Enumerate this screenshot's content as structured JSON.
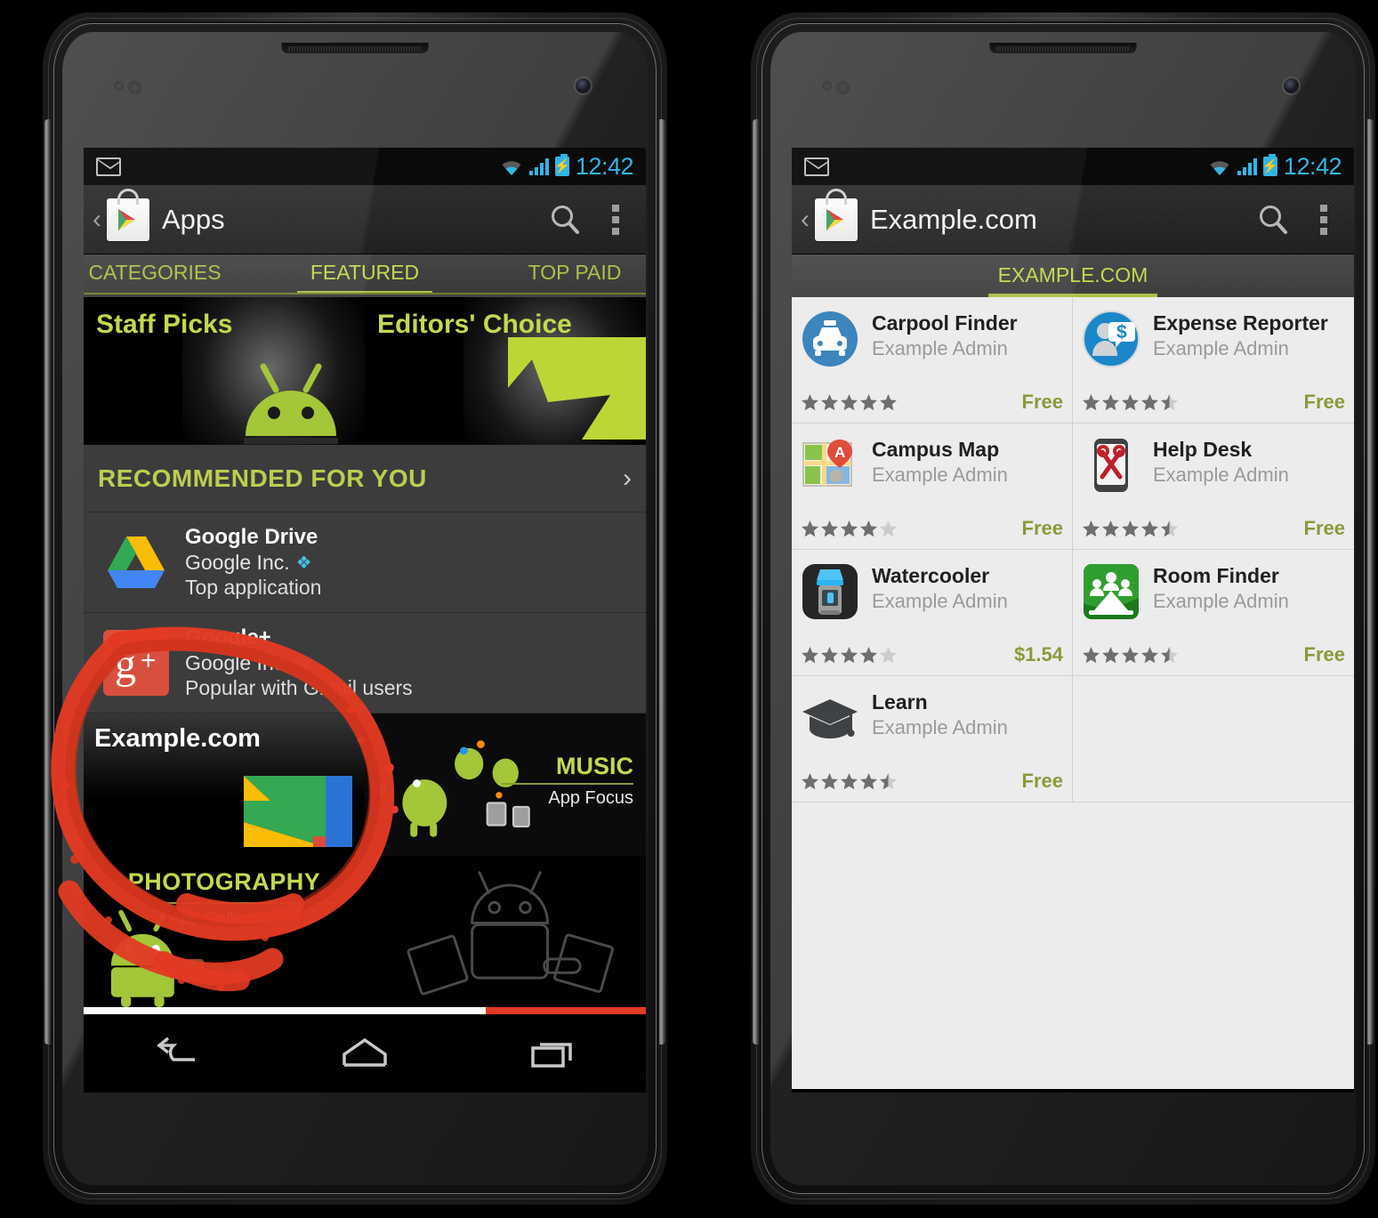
{
  "phones": [
    {
      "id": "left",
      "status_bar": {
        "notification_icon": "gmail-icon",
        "wifi_icon": "wifi-icon",
        "signal_icon": "signal-bars-icon",
        "battery_icon": "battery-charging-icon",
        "clock": "12:42"
      },
      "action_bar": {
        "back_glyph": "‹",
        "app_icon": "play-store-bag-icon",
        "title": "Apps",
        "search_icon": "search-icon",
        "overflow_icon": "overflow-menu-icon"
      },
      "tabs": [
        {
          "label": "CATEGORIES",
          "active": false
        },
        {
          "label": "FEATURED",
          "active": true
        },
        {
          "label": "TOP PAID",
          "active": false
        }
      ],
      "banners": [
        {
          "label": "Staff Picks",
          "art": "android-droid-icon"
        },
        {
          "label": "Editors' Choice",
          "art": "green-arrow-shape-icon"
        }
      ],
      "section": {
        "title": "RECOMMENDED FOR YOU",
        "chevron": "›"
      },
      "recommendations": [
        {
          "icon": "google-drive-icon",
          "title": "Google Drive",
          "developer": "Google Inc.",
          "verified_badge": "❖",
          "note": "Top application"
        },
        {
          "icon": "google-plus-icon",
          "title": "Google+",
          "developer": "Google Inc.",
          "verified_badge": "❖",
          "note": "Popular with Gmail users"
        }
      ],
      "promos": [
        {
          "label": "Example.com",
          "art": "google-docs-mark-icon"
        },
        {
          "label": "MUSIC",
          "sublabel": "App Focus",
          "art": "dancing-droids-icon"
        },
        {
          "label": "PHOTOGRAPHY",
          "sublabel": "App Collection",
          "art": "droid-camera-icon"
        }
      ],
      "nav_bar": {
        "back": "nav-back-icon",
        "home": "nav-home-icon",
        "recents": "nav-recents-icon"
      }
    },
    {
      "id": "right",
      "status_bar": {
        "notification_icon": "gmail-icon",
        "wifi_icon": "wifi-icon",
        "signal_icon": "signal-bars-icon",
        "battery_icon": "battery-charging-icon",
        "clock": "12:42"
      },
      "action_bar": {
        "back_glyph": "‹",
        "app_icon": "play-store-bag-icon",
        "title": "Example.com",
        "search_icon": "search-icon",
        "overflow_icon": "overflow-menu-icon"
      },
      "tabs": [
        {
          "label": "EXAMPLE.COM",
          "active": true
        }
      ],
      "apps": [
        {
          "icon": "carpool-car-icon",
          "name": "Carpool Finder",
          "developer": "Example Admin",
          "rating": 5.0,
          "price": "Free"
        },
        {
          "icon": "expense-report-icon",
          "name": "Expense Reporter",
          "developer": "Example Admin",
          "rating": 4.5,
          "price": "Free"
        },
        {
          "icon": "campus-map-icon",
          "name": "Campus Map",
          "developer": "Example Admin",
          "rating": 4.0,
          "price": "Free"
        },
        {
          "icon": "help-desk-tools-icon",
          "name": "Help Desk",
          "developer": "Example Admin",
          "rating": 4.5,
          "price": "Free"
        },
        {
          "icon": "watercooler-icon",
          "name": "Watercooler",
          "developer": "Example Admin",
          "rating": 4.0,
          "price": "$1.54"
        },
        {
          "icon": "room-finder-icon",
          "name": "Room Finder",
          "developer": "Example Admin",
          "rating": 4.5,
          "price": "Free"
        },
        {
          "icon": "graduation-cap-icon",
          "name": "Learn",
          "developer": "Example Admin",
          "rating": 4.5,
          "price": "Free"
        }
      ],
      "nav_bar": {
        "back": "nav-back-icon",
        "home": "nav-home-icon",
        "recents": "nav-recents-icon"
      }
    }
  ],
  "annotation": {
    "kind": "hand-drawn-red-circle",
    "color": "#e23a22",
    "targets": "Example.com promo tile"
  },
  "colors": {
    "accent_green": "#aac148",
    "accent_blue": "#33b5e5",
    "price_green": "#8a9a3a",
    "annotation_red": "#e23a22",
    "list_bg": "#ececec",
    "dark_bg": "#3c3c3c"
  }
}
